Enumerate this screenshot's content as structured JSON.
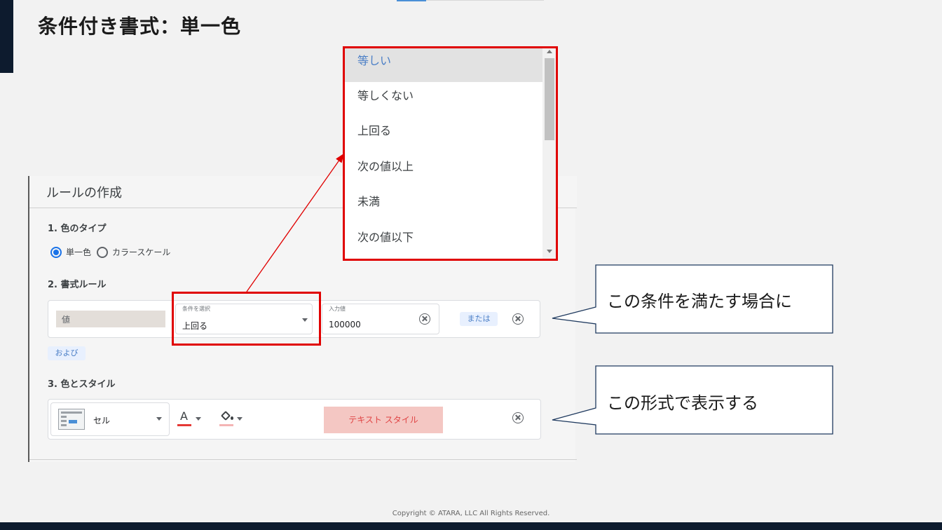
{
  "slide": {
    "title": "条件付き書式：単一色",
    "copyright": "Copyright © ATARA, LLC All Rights Reserved."
  },
  "panel": {
    "title": "ルールの作成",
    "section1": "1. 色のタイプ",
    "radio_single": "単一色",
    "radio_scale": "カラースケール",
    "section2": "2. 書式ルール",
    "value_chip": "値",
    "condition_label": "条件を選択",
    "condition_value": "上回る",
    "input_label": "入力値",
    "input_value": "100000",
    "or_label": "または",
    "and_label": "および",
    "section3": "3. 色とスタイル",
    "cell_label": "セル",
    "font_letter": "A",
    "preview_text": "テキスト スタイル"
  },
  "dropdown": {
    "items": [
      "等しい",
      "等しくない",
      "上回る",
      "次の値以上",
      "未満",
      "次の値以下"
    ]
  },
  "callouts": {
    "condition": "この条件を満たす場合に",
    "format": "この形式で表示する"
  },
  "colors": {
    "highlight_red": "#e00000",
    "accent_blue": "#1a73e8",
    "preview_bg": "#f4c7c3",
    "navy": "#0d1b2e"
  }
}
